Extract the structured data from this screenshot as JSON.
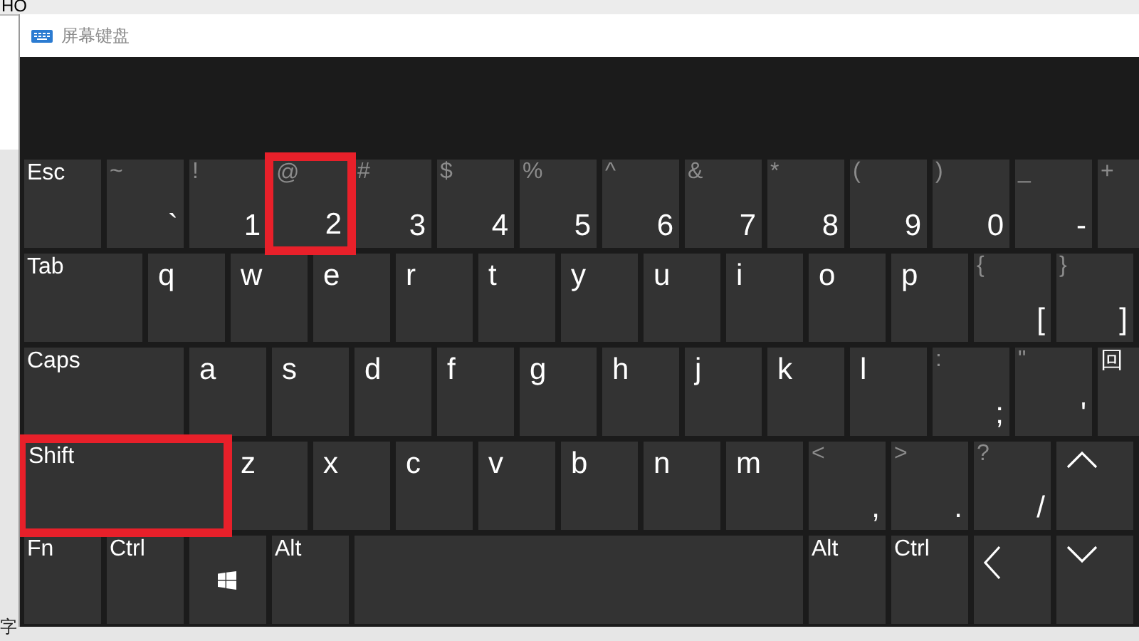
{
  "background": {
    "top_text": "HO",
    "bottom_text": "字"
  },
  "window": {
    "title": "屏幕键盘"
  },
  "rows": [
    {
      "keys": [
        {
          "kind": "label",
          "label": "Esc",
          "highlighted": false
        },
        {
          "kind": "dual",
          "shift": "~",
          "main": "`",
          "highlighted": false
        },
        {
          "kind": "dual",
          "shift": "!",
          "main": "1",
          "highlighted": false
        },
        {
          "kind": "dual",
          "shift": "@",
          "main": "2",
          "highlighted": true
        },
        {
          "kind": "dual",
          "shift": "#",
          "main": "3",
          "highlighted": false
        },
        {
          "kind": "dual",
          "shift": "$",
          "main": "4",
          "highlighted": false
        },
        {
          "kind": "dual",
          "shift": "%",
          "main": "5",
          "highlighted": false
        },
        {
          "kind": "dual",
          "shift": "^",
          "main": "6",
          "highlighted": false
        },
        {
          "kind": "dual",
          "shift": "&",
          "main": "7",
          "highlighted": false
        },
        {
          "kind": "dual",
          "shift": "*",
          "main": "8",
          "highlighted": false
        },
        {
          "kind": "dual",
          "shift": "(",
          "main": "9",
          "highlighted": false
        },
        {
          "kind": "dual",
          "shift": ")",
          "main": "0",
          "highlighted": false
        },
        {
          "kind": "dual",
          "shift": "_",
          "main": "-",
          "highlighted": false
        },
        {
          "kind": "dual",
          "shift": "+",
          "highlighted": false
        }
      ]
    },
    {
      "keys": [
        {
          "kind": "label",
          "label": "Tab",
          "highlighted": false
        },
        {
          "kind": "letter",
          "label": "q",
          "highlighted": false
        },
        {
          "kind": "letter",
          "label": "w",
          "highlighted": false
        },
        {
          "kind": "letter",
          "label": "e",
          "highlighted": false
        },
        {
          "kind": "letter",
          "label": "r",
          "highlighted": false
        },
        {
          "kind": "letter",
          "label": "t",
          "highlighted": false
        },
        {
          "kind": "letter",
          "label": "y",
          "highlighted": false
        },
        {
          "kind": "letter",
          "label": "u",
          "highlighted": false
        },
        {
          "kind": "letter",
          "label": "i",
          "highlighted": false
        },
        {
          "kind": "letter",
          "label": "o",
          "highlighted": false
        },
        {
          "kind": "letter",
          "label": "p",
          "highlighted": false
        },
        {
          "kind": "dual",
          "shift": "{",
          "main": "[",
          "highlighted": false
        },
        {
          "kind": "dual",
          "shift": "}",
          "main": "]",
          "highlighted": false
        }
      ]
    },
    {
      "keys": [
        {
          "kind": "label",
          "label": "Caps",
          "highlighted": false
        },
        {
          "kind": "letter",
          "label": "a",
          "highlighted": false
        },
        {
          "kind": "letter",
          "label": "s",
          "highlighted": false
        },
        {
          "kind": "letter",
          "label": "d",
          "highlighted": false
        },
        {
          "kind": "letter",
          "label": "f",
          "highlighted": false
        },
        {
          "kind": "letter",
          "label": "g",
          "highlighted": false
        },
        {
          "kind": "letter",
          "label": "h",
          "highlighted": false
        },
        {
          "kind": "letter",
          "label": "j",
          "highlighted": false
        },
        {
          "kind": "letter",
          "label": "k",
          "highlighted": false
        },
        {
          "kind": "letter",
          "label": "l",
          "highlighted": false
        },
        {
          "kind": "dual",
          "shift": ":",
          "main": ";",
          "highlighted": false
        },
        {
          "kind": "dual",
          "shift": "\"",
          "main": "'",
          "highlighted": false
        },
        {
          "kind": "label",
          "label": "回",
          "highlighted": false
        }
      ]
    },
    {
      "keys": [
        {
          "kind": "label",
          "label": "Shift",
          "highlighted": true
        },
        {
          "kind": "letter",
          "label": "z",
          "highlighted": false
        },
        {
          "kind": "letter",
          "label": "x",
          "highlighted": false
        },
        {
          "kind": "letter",
          "label": "c",
          "highlighted": false
        },
        {
          "kind": "letter",
          "label": "v",
          "highlighted": false
        },
        {
          "kind": "letter",
          "label": "b",
          "highlighted": false
        },
        {
          "kind": "letter",
          "label": "n",
          "highlighted": false
        },
        {
          "kind": "letter",
          "label": "m",
          "highlighted": false
        },
        {
          "kind": "dual",
          "shift": "<",
          "main": ",",
          "highlighted": false
        },
        {
          "kind": "dual",
          "shift": ">",
          "main": ".",
          "highlighted": false
        },
        {
          "kind": "dual",
          "shift": "?",
          "main": "/",
          "highlighted": false
        },
        {
          "kind": "up",
          "highlighted": false
        }
      ]
    },
    {
      "keys": [
        {
          "kind": "label",
          "label": "Fn",
          "highlighted": false
        },
        {
          "kind": "label",
          "label": "Ctrl",
          "highlighted": false
        },
        {
          "kind": "windows",
          "highlighted": false
        },
        {
          "kind": "label",
          "label": "Alt",
          "highlighted": false
        },
        {
          "kind": "space",
          "highlighted": false
        },
        {
          "kind": "label",
          "label": "Alt",
          "highlighted": false
        },
        {
          "kind": "label",
          "label": "Ctrl",
          "highlighted": false
        },
        {
          "kind": "left",
          "highlighted": false
        },
        {
          "kind": "down",
          "highlighted": false
        }
      ]
    }
  ]
}
